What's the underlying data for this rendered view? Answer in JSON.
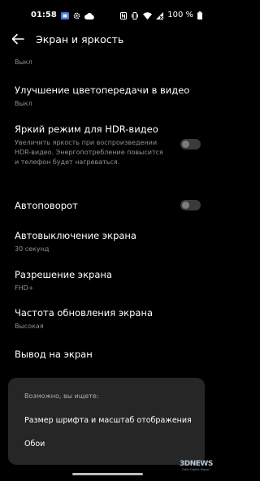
{
  "status": {
    "time": "01:58",
    "battery_text": "100 %",
    "icons": [
      "sim-icon",
      "gear-icon",
      "cloud-icon",
      "nfc-icon",
      "vibrate-icon",
      "wifi-icon",
      "signal-icon",
      "battery-icon"
    ]
  },
  "header": {
    "title": "Экран и яркость",
    "back_icon": "arrow-left-icon"
  },
  "settings": {
    "partial": {
      "sub": "Выкл"
    },
    "color_enhance": {
      "title": "Улучшение цветопередачи в видео",
      "sub": "Выкл"
    },
    "hdr_bright": {
      "title": "Яркий режим для HDR-видео",
      "sub": "Увеличить яркость при воспроизведении HDR-видео. Энергопотребление повысится и телефон будет нагреваться.",
      "enabled": false
    },
    "autorotate": {
      "title": "Автоповорот",
      "enabled": false
    },
    "screen_timeout": {
      "title": "Автовыключение экрана",
      "sub": "30 секунд"
    },
    "resolution": {
      "title": "Разрешение экрана",
      "sub": "FHD+"
    },
    "refresh_rate": {
      "title": "Частота обновления экрана",
      "sub": "Высокая"
    },
    "cast": {
      "title": "Вывод на экран"
    }
  },
  "suggestions": {
    "heading": "Возможно, вы ищете:",
    "items": [
      "Размер шрифта и масштаб отображения",
      "Обои"
    ]
  },
  "watermark": {
    "big": "3DNEWS",
    "small": "Daily Digital Digest"
  },
  "colors": {
    "background": "#000000",
    "card": "#262626",
    "subtext": "#8f8f8f"
  }
}
